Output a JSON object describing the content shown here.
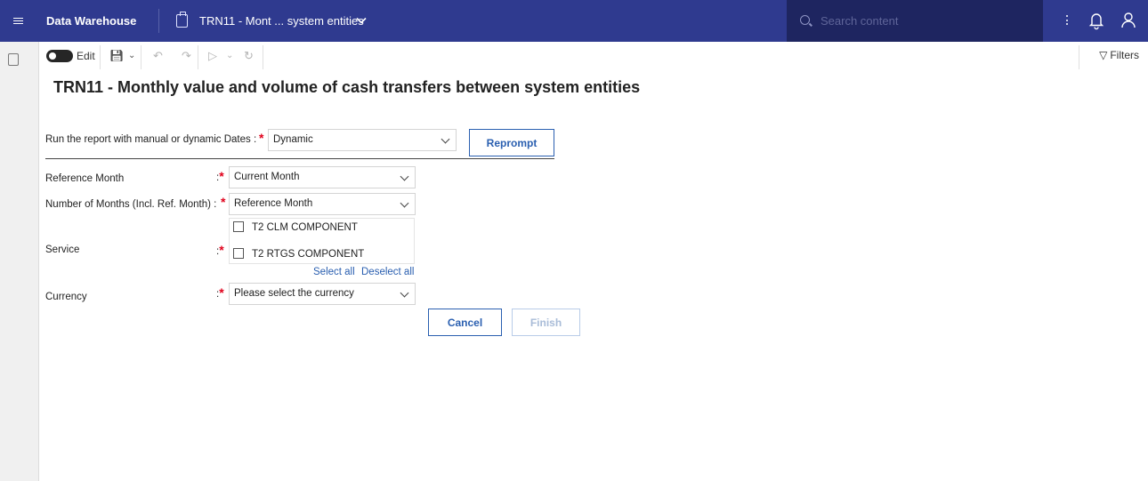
{
  "topbar": {
    "app_title": "Data Warehouse",
    "doc_title": "TRN11 - Mont ... system entities",
    "search_placeholder": "Search content"
  },
  "toolbar": {
    "edit_label": "Edit",
    "filters_label": "Filters"
  },
  "report": {
    "title": "TRN11 - Monthly value and volume of cash transfers between system entities"
  },
  "prompt": {
    "dates_label": "Run the report with manual or dynamic Dates :",
    "dates_value": "Dynamic",
    "reprompt_label": "Reprompt",
    "reference_month_label": "Reference Month",
    "reference_month_value": "Current Month",
    "num_months_label": "Number of Months (Incl. Ref. Month) :",
    "num_months_value": "Reference Month",
    "service_label": "Service",
    "service_options": [
      "T2 CLM COMPONENT",
      "T2 RTGS COMPONENT"
    ],
    "select_all_label": "Select all",
    "deselect_all_label": "Deselect all",
    "currency_label": "Currency",
    "currency_placeholder": "Please select the currency",
    "colon": ":",
    "required_mark": "*",
    "cancel_label": "Cancel",
    "finish_label": "Finish"
  },
  "colors": {
    "topbar_bg": "#2f3a8f",
    "search_bg": "#1e2560",
    "accent": "#2a5fb0",
    "required": "#e0001b"
  }
}
